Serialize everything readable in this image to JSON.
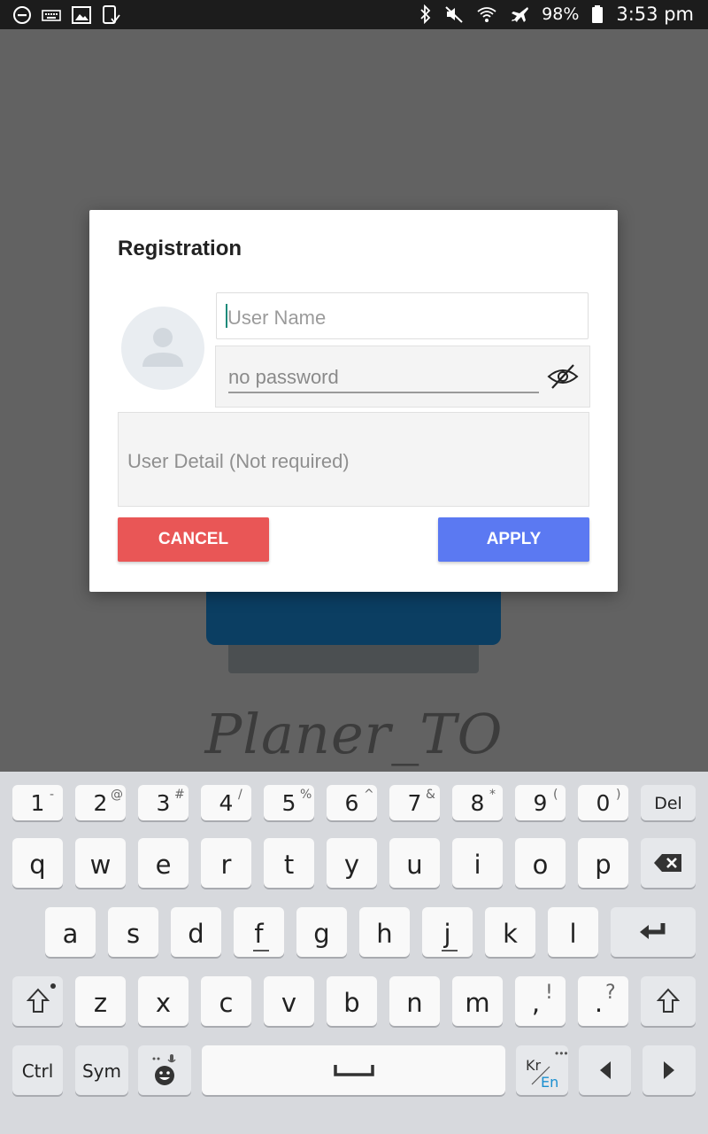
{
  "status_bar": {
    "battery": "98%",
    "time": "3:53 pm",
    "left_icons": [
      "dnd-icon",
      "keyboard-icon",
      "gallery-icon",
      "screen-icon"
    ],
    "right_icons": [
      "bluetooth-icon",
      "mute-icon",
      "wifi-icon",
      "airplane-icon",
      "battery-icon"
    ]
  },
  "background": {
    "brand": "Planer_TO"
  },
  "dialog": {
    "title": "Registration",
    "username_placeholder": "User Name",
    "password_placeholder": "no password",
    "detail_placeholder": "User Detail (Not required)",
    "cancel_label": "CANCEL",
    "apply_label": "APPLY",
    "cancel_color": "#e95656",
    "apply_color": "#5b79f2"
  },
  "keyboard": {
    "number_row": [
      {
        "key": "1",
        "sup": "-"
      },
      {
        "key": "2",
        "sup": "@"
      },
      {
        "key": "3",
        "sup": "#"
      },
      {
        "key": "4",
        "sup": "/"
      },
      {
        "key": "5",
        "sup": "%"
      },
      {
        "key": "6",
        "sup": "^"
      },
      {
        "key": "7",
        "sup": "&"
      },
      {
        "key": "8",
        "sup": "*"
      },
      {
        "key": "9",
        "sup": "("
      },
      {
        "key": "0",
        "sup": ")"
      }
    ],
    "del_label": "Del",
    "row1": [
      "q",
      "w",
      "e",
      "r",
      "t",
      "y",
      "u",
      "i",
      "o",
      "p"
    ],
    "row2": [
      "a",
      "s",
      "d",
      "f",
      "g",
      "h",
      "j",
      "k",
      "l"
    ],
    "row3": [
      "z",
      "x",
      "c",
      "v",
      "b",
      "n",
      "m"
    ],
    "comma": {
      "key": ",",
      "sup": "!"
    },
    "period": {
      "key": ".",
      "sup": "?"
    },
    "ctrl_label": "Ctrl",
    "sym_label": "Sym",
    "lang_kr": "Kr",
    "lang_en": "En"
  }
}
